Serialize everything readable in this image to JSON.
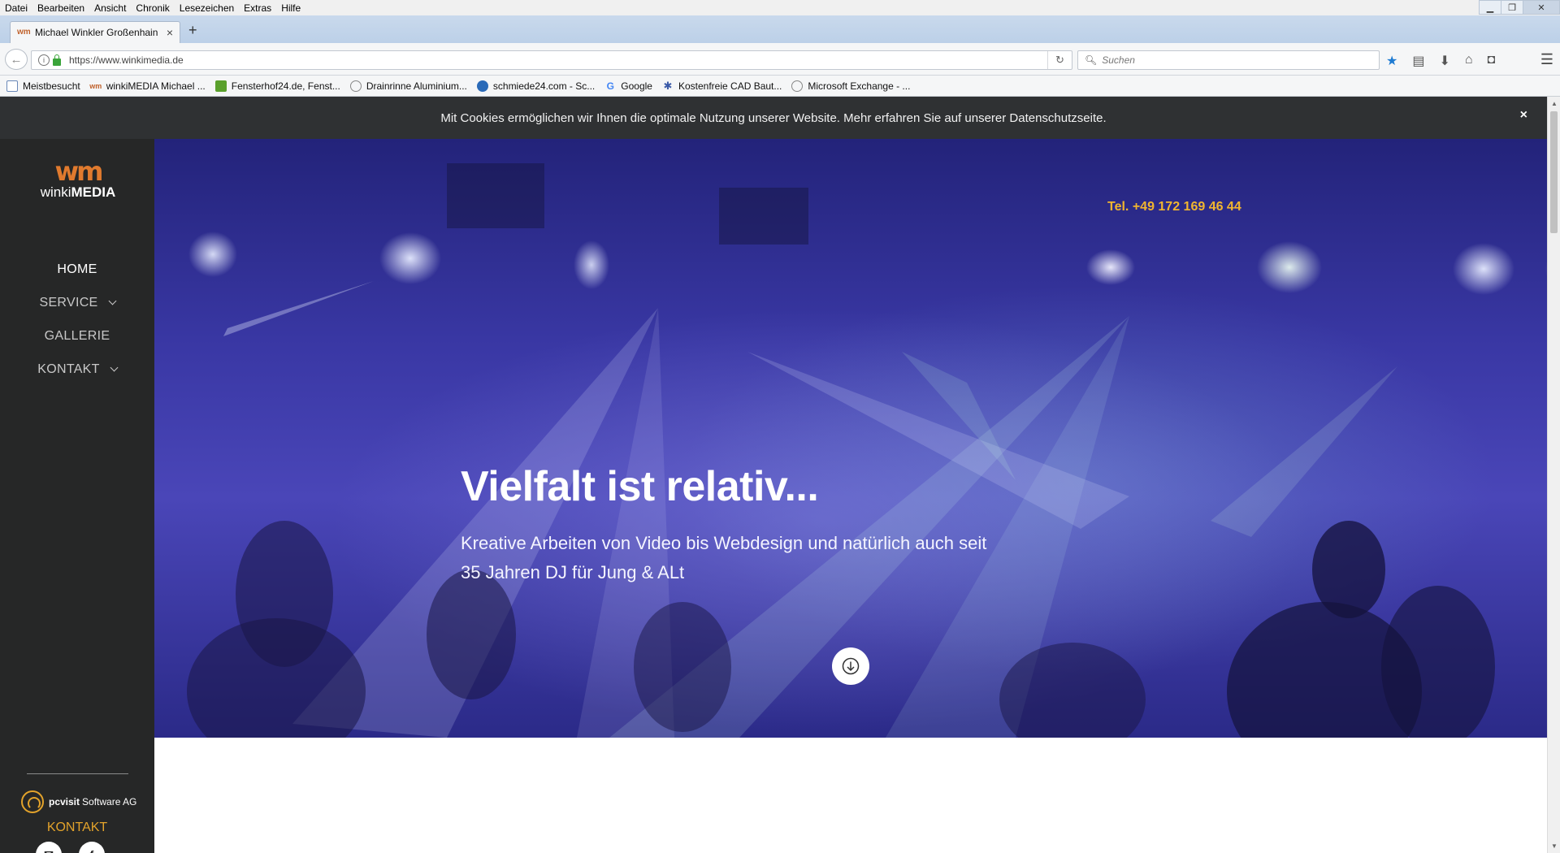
{
  "browser": {
    "menu": [
      "Datei",
      "Bearbeiten",
      "Ansicht",
      "Chronik",
      "Lesezeichen",
      "Extras",
      "Hilfe"
    ],
    "tab": {
      "title": "Michael Winkler Großenhain",
      "favicon": "wm"
    },
    "url": "https://www.winkimedia.de",
    "search_placeholder": "Suchen",
    "bookmarks": [
      {
        "label": "Meistbesucht",
        "icon": "folder-icon"
      },
      {
        "label": "winkiMEDIA Michael ...",
        "icon": "wm-icon"
      },
      {
        "label": "Fensterhof24.de, Fenst...",
        "icon": "green-square-icon"
      },
      {
        "label": "Drainrinne Aluminium...",
        "icon": "globe-icon"
      },
      {
        "label": "schmiede24.com - Sc...",
        "icon": "blue-round-icon"
      },
      {
        "label": "Google",
        "icon": "google-icon"
      },
      {
        "label": "Kostenfreie CAD Baut...",
        "icon": "gear-icon"
      },
      {
        "label": "Microsoft Exchange - ...",
        "icon": "globe-icon"
      }
    ]
  },
  "cookie_notice": "Mit Cookies ermöglichen wir Ihnen die optimale Nutzung unserer Website. Mehr erfahren Sie auf unserer Datenschutzseite.",
  "cookie_close": "×",
  "sidebar": {
    "logo_mark": "wm",
    "logo_text_light": "winki",
    "logo_text_bold": "MEDIA",
    "nav": [
      {
        "label": "HOME",
        "active": true,
        "dropdown": false
      },
      {
        "label": "SERVICE",
        "active": false,
        "dropdown": true
      },
      {
        "label": "GALLERIE",
        "active": false,
        "dropdown": false
      },
      {
        "label": "KONTAKT",
        "active": false,
        "dropdown": true
      }
    ],
    "partner_bold": "pcvisit",
    "partner_rest": "Software AG",
    "contact_label": "KONTAKT",
    "social": [
      {
        "icon": "email-icon",
        "glyph": "✉"
      },
      {
        "icon": "facebook-icon",
        "glyph": "f"
      }
    ]
  },
  "hero": {
    "phone": "Tel. +49 172 169 46 44",
    "title": "Vielfalt ist relativ...",
    "subtitle": "Kreative Arbeiten von Video bis Webdesign und natürlich auch seit 35 Jahren DJ für Jung & ALt"
  },
  "colors": {
    "sidebar_bg": "#262727",
    "accent": "#e3a32b",
    "phone": "#f1b52f",
    "cookie_bg": "#2f3133"
  }
}
